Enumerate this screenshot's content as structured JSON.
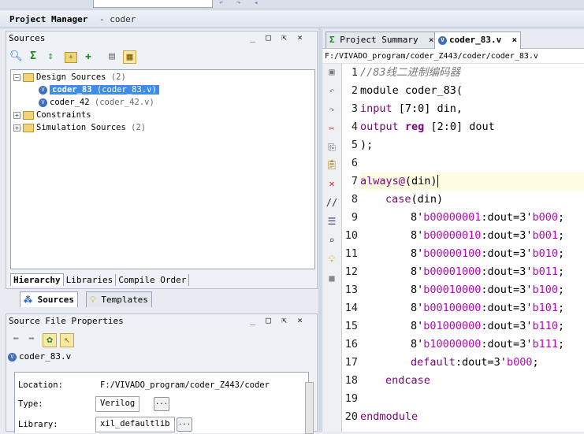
{
  "top_toolbar": {
    "icons": [
      "undo-icon",
      "redo-icon",
      "back-icon"
    ]
  },
  "project_manager": {
    "title": "Project Manager",
    "project": "- coder"
  },
  "sources_panel": {
    "title": "Sources",
    "toolbar_icons": [
      "search-icon",
      "collapse-all-icon",
      "expand-all-icon",
      "add-sources-icon",
      "add-hierarchy-icon",
      "document-icon",
      "properties-icon"
    ],
    "tree": {
      "design_sources": {
        "label": "Design Sources",
        "count": "(2)"
      },
      "coder_83": {
        "name": "coder_83",
        "file": "(coder_83.v)"
      },
      "coder_42": {
        "name": "coder_42",
        "file": "(coder_42.v)"
      },
      "constraints": {
        "label": "Constraints"
      },
      "simulation_sources": {
        "label": "Simulation Sources",
        "count": "(2)"
      }
    },
    "tabs": [
      "Hierarchy",
      "Libraries",
      "Compile Order"
    ]
  },
  "bottom_tabs": {
    "sources": "Sources",
    "templates": "Templates"
  },
  "properties_panel": {
    "title": "Source File Properties",
    "file_name": "coder_83.v",
    "location_label": "Location:",
    "location_value": "F:/VIVADO_program/coder_Z443/coder",
    "type_label": "Type:",
    "type_value": "Verilog",
    "library_label": "Library:",
    "library_value": "xil_defaultlib",
    "ellipsis": "..."
  },
  "editor": {
    "tabs": [
      {
        "label": "Project Summary",
        "active": false
      },
      {
        "label": "coder_83.v",
        "active": true
      }
    ],
    "path": "F:/VIVADO_program/coder_Z443/coder/coder_83.v",
    "line_numbers": [
      "1",
      "2",
      "3",
      "4",
      "5",
      "6",
      "7",
      "8",
      "9",
      "10",
      "11",
      "12",
      "13",
      "14",
      "15",
      "16",
      "17",
      "18",
      "19",
      "20"
    ],
    "code": {
      "l1": "//83线二进制编码器",
      "l2": "module coder_83(",
      "l3a": "input",
      "l3b": " [7:0] din,",
      "l4a": "output",
      "l4b": "reg",
      "l4c": " [2:0] dout",
      "l5": ");",
      "l7a": "always",
      "l7b": "@",
      "l7c": "(din)",
      "l8a": "case",
      "l8b": "(din)",
      "cases": [
        {
          "a": "8'",
          "b": "b00000001",
          "c": ":dout=3'",
          "d": "b000",
          "e": ";"
        },
        {
          "a": "8'",
          "b": "b00000010",
          "c": ":dout=3'",
          "d": "b001",
          "e": ";"
        },
        {
          "a": "8'",
          "b": "b00000100",
          "c": ":dout=3'",
          "d": "b010",
          "e": ";"
        },
        {
          "a": "8'",
          "b": "b00001000",
          "c": ":dout=3'",
          "d": "b011",
          "e": ";"
        },
        {
          "a": "8'",
          "b": "b00010000",
          "c": ":dout=3'",
          "d": "b100",
          "e": ";"
        },
        {
          "a": "8'",
          "b": "b00100000",
          "c": ":dout=3'",
          "d": "b101",
          "e": ";"
        },
        {
          "a": "8'",
          "b": "b01000000",
          "c": ":dout=3'",
          "d": "b110",
          "e": ";"
        },
        {
          "a": "8'",
          "b": "b10000000",
          "c": ":dout=3'",
          "d": "b111",
          "e": ";"
        }
      ],
      "l17a": "default",
      "l17b": ":dout=3'",
      "l17c": "b000",
      "l17d": ";",
      "l18": "endcase",
      "l20": "endmodule"
    }
  }
}
